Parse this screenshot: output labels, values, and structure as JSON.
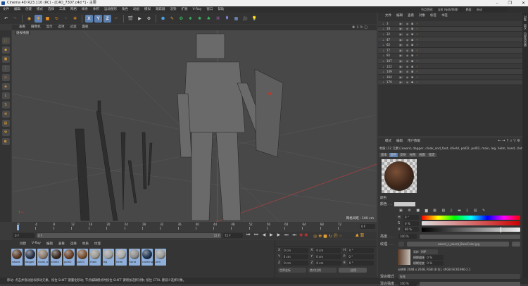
{
  "window": {
    "title": "Cinema 4D R23.110 (RC) - [C4D_7307.c4d *] - 主要",
    "minimize": "–",
    "maximize": "❐",
    "close": "✕"
  },
  "menu": [
    "文件",
    "编辑",
    "创建",
    "模式",
    "选择",
    "工具",
    "网格",
    "样条",
    "体积",
    "运动图形",
    "角色",
    "动画",
    "模拟",
    "跟踪器",
    "渲染",
    "扩展",
    "V-Ray",
    "窗口",
    "帮助"
  ],
  "layout": {
    "node_space_label": "节点空间:",
    "node_space_value": "当前 (标准/物理)",
    "interface_label": "界面:",
    "interface_value": "启动"
  },
  "toolbar": {
    "x": "X",
    "y": "Y",
    "z": "Z"
  },
  "viewport": {
    "menu": [
      "查看",
      "摄像机",
      "显示",
      "选项",
      "过滤",
      "面板"
    ],
    "label": "透视视图",
    "grid_spacing": "网格间距 : 100 cm"
  },
  "timeline": {
    "ticks": [
      "0",
      "4",
      "8",
      "12",
      "16",
      "20",
      "24",
      "28",
      "32",
      "36",
      "40",
      "44",
      "48",
      "52",
      "56",
      "60",
      "64",
      "68",
      "72"
    ],
    "current_frame": "0 F",
    "start": "0 F",
    "range_start": "0 F",
    "range_end": "72 F",
    "end": "72 F"
  },
  "material_manager": {
    "menu": [
      "创建",
      "V-Ray",
      "编辑",
      "查看",
      "选择",
      "材质",
      "纹理"
    ],
    "materials": [
      {
        "name": "sword",
        "color": "#5a3a28"
      },
      {
        "name": "dagger",
        "color": "#2a3448"
      },
      {
        "name": "cloak_a",
        "color": "#8a7a6a"
      },
      {
        "name": "shield",
        "color": "#3a2a20"
      },
      {
        "name": "pol02",
        "color": "#6a4028"
      },
      {
        "name": "pol01",
        "color": "#7a5030"
      },
      {
        "name": "main",
        "color": "#9a9890"
      },
      {
        "name": "leg",
        "color": "#a0a0a0"
      },
      {
        "name": "helm",
        "color": "#a8a8a8"
      },
      {
        "name": "hand",
        "color": "#8a8a88"
      },
      {
        "name": "clothing",
        "color": "#1e3450"
      },
      {
        "name": "arm",
        "color": "#9a9a98"
      }
    ]
  },
  "coordinates": {
    "rows": [
      {
        "a": "X",
        "av": "0 cm",
        "b": "X",
        "bv": "0 cm",
        "c": "H",
        "cv": "0 °"
      },
      {
        "a": "Y",
        "av": "0 cm",
        "b": "Y",
        "bv": "0 cm",
        "c": "P",
        "cv": "0 °"
      },
      {
        "a": "Z",
        "av": "0 cm",
        "b": "Z",
        "bv": "0 cm",
        "c": "B",
        "cv": "0 °"
      }
    ],
    "mode": "世界坐标",
    "scale": "绝对比例",
    "apply": "应用"
  },
  "status": "移动: 点击并拖动鼠标移动元素。按住 SHIFT 键量化移动; 节点编辑模式时按住 SHIFT 键增加选择对象; 按住 CTRL 键减少选择对象。",
  "object_manager": {
    "menu": [
      "文件",
      "编辑",
      "查看",
      "对象",
      "标签",
      "书签"
    ],
    "objects": [
      "3",
      "18",
      "32",
      "47",
      "62",
      "77",
      "92",
      "107",
      "122",
      "149",
      "164",
      "179"
    ]
  },
  "attributes": {
    "menu": [
      "模式",
      "编辑",
      "用户数据"
    ],
    "title": "材质 (12 元素) [sword, dagger, cloak_and_foot, shield, pol02, pol01, main, leg, helm, hand, clothi",
    "tabs": [
      "基本",
      "颜色",
      "反射",
      "光照",
      "视窗",
      "指定"
    ],
    "active_tab": "颜色",
    "section": "颜色",
    "color_label": "颜色 . .",
    "h_label": "H",
    "h": "0 °",
    "s_label": "S",
    "s": "0 %",
    "v_label": "V",
    "v": "80 %",
    "v_fraction": 0.8,
    "brightness_label": "亮度 . . .",
    "brightness": "100 %",
    "texture_label": "纹理 . . .",
    "texture": "sword_L_sword_BaseColor.jpg",
    "more": "...",
    "sampling_label": "采样",
    "sampling": "MIP",
    "blur_offset_label": "模糊偏移",
    "blur_offset": "0 %",
    "blur_scale_label": "模糊程度",
    "blur_scale": "0 %",
    "resolution": "分辨率 2048 x 2048, RGB (8 位), sRGB IEC61966-2.1",
    "mix_mode_label": "混合模式",
    "mix_mode": "标准",
    "mix_strength_label": "混合强度",
    "mix_strength": "100 %"
  },
  "side_tabs": [
    "对象",
    "层次",
    "内容浏览器"
  ]
}
